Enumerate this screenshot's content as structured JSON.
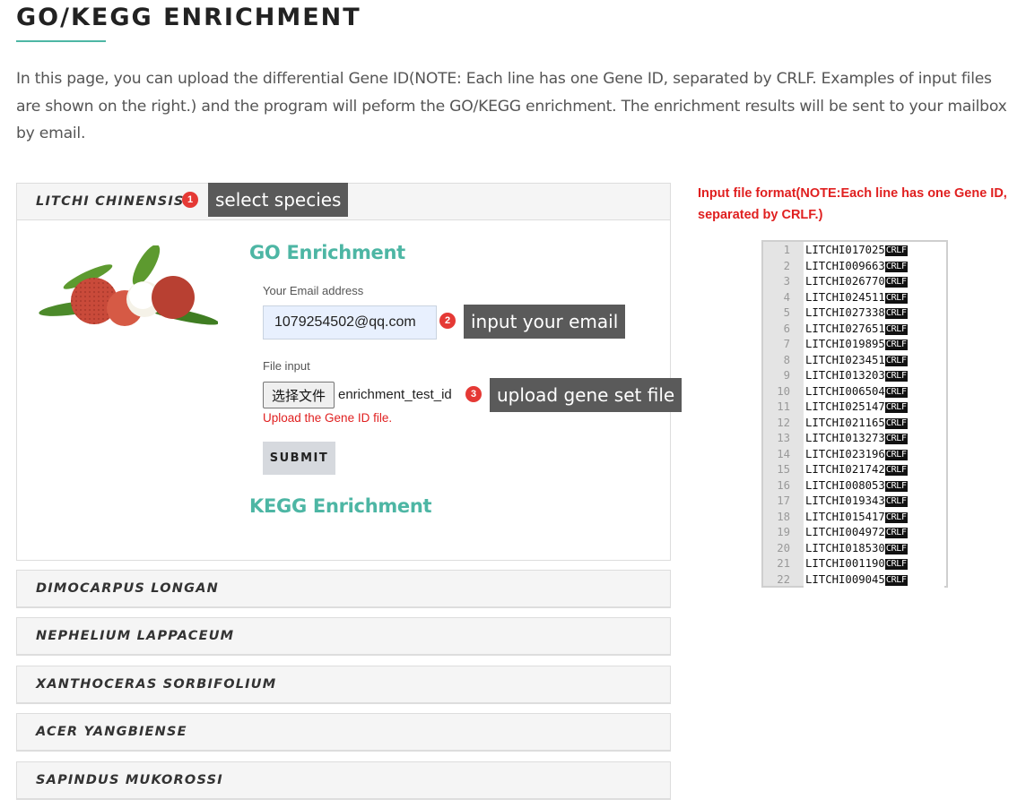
{
  "page": {
    "title": "GO/KEGG ENRICHMENT",
    "intro": "In this page, you can upload the differential Gene ID(NOTE: Each line has one Gene ID, separated by CRLF. Examples of input files are shown on the right.) and the program will peform the GO/KEGG enrichment. The enrichment results will be sent to your mailbox by email.",
    "accent_color": "#4db6a4",
    "error_color": "#e02020"
  },
  "species_panels": [
    {
      "name": "LITCHI CHINENSIS",
      "expanded": true
    },
    {
      "name": "DIMOCARPUS LONGAN",
      "expanded": false
    },
    {
      "name": "NEPHELIUM LAPPACEUM",
      "expanded": false
    },
    {
      "name": "XANTHOCERAS SORBIFOLIUM",
      "expanded": false
    },
    {
      "name": "ACER YANGBIENSE",
      "expanded": false
    },
    {
      "name": "SAPINDUS MUKOROSSI",
      "expanded": false
    }
  ],
  "callouts": [
    {
      "number": "1",
      "text": "select species"
    },
    {
      "number": "2",
      "text": "input your email"
    },
    {
      "number": "3",
      "text": "upload gene set file"
    }
  ],
  "go_form": {
    "heading": "GO Enrichment",
    "email_label": "Your Email address",
    "email_value": "1079254502@qq.com",
    "file_label": "File input",
    "file_button": "选择文件",
    "file_name": "enrichment_test_id",
    "file_help": "Upload the Gene ID file.",
    "submit_label": "SUBMIT"
  },
  "kegg_heading": "KEGG Enrichment",
  "format_note": "Input file format(NOTE:Each line has one Gene ID, separated by CRLF.)",
  "example_file": {
    "line_ending": "CRLF",
    "lines": [
      "LITCHI017025",
      "LITCHI009663",
      "LITCHI026770",
      "LITCHI024511",
      "LITCHI027338",
      "LITCHI027651",
      "LITCHI019895",
      "LITCHI023451",
      "LITCHI013203",
      "LITCHI006504",
      "LITCHI025147",
      "LITCHI021165",
      "LITCHI013273",
      "LITCHI023196",
      "LITCHI021742",
      "LITCHI008053",
      "LITCHI019343",
      "LITCHI015417",
      "LITCHI004972",
      "LITCHI018530",
      "LITCHI001190",
      "LITCHI009045"
    ]
  }
}
